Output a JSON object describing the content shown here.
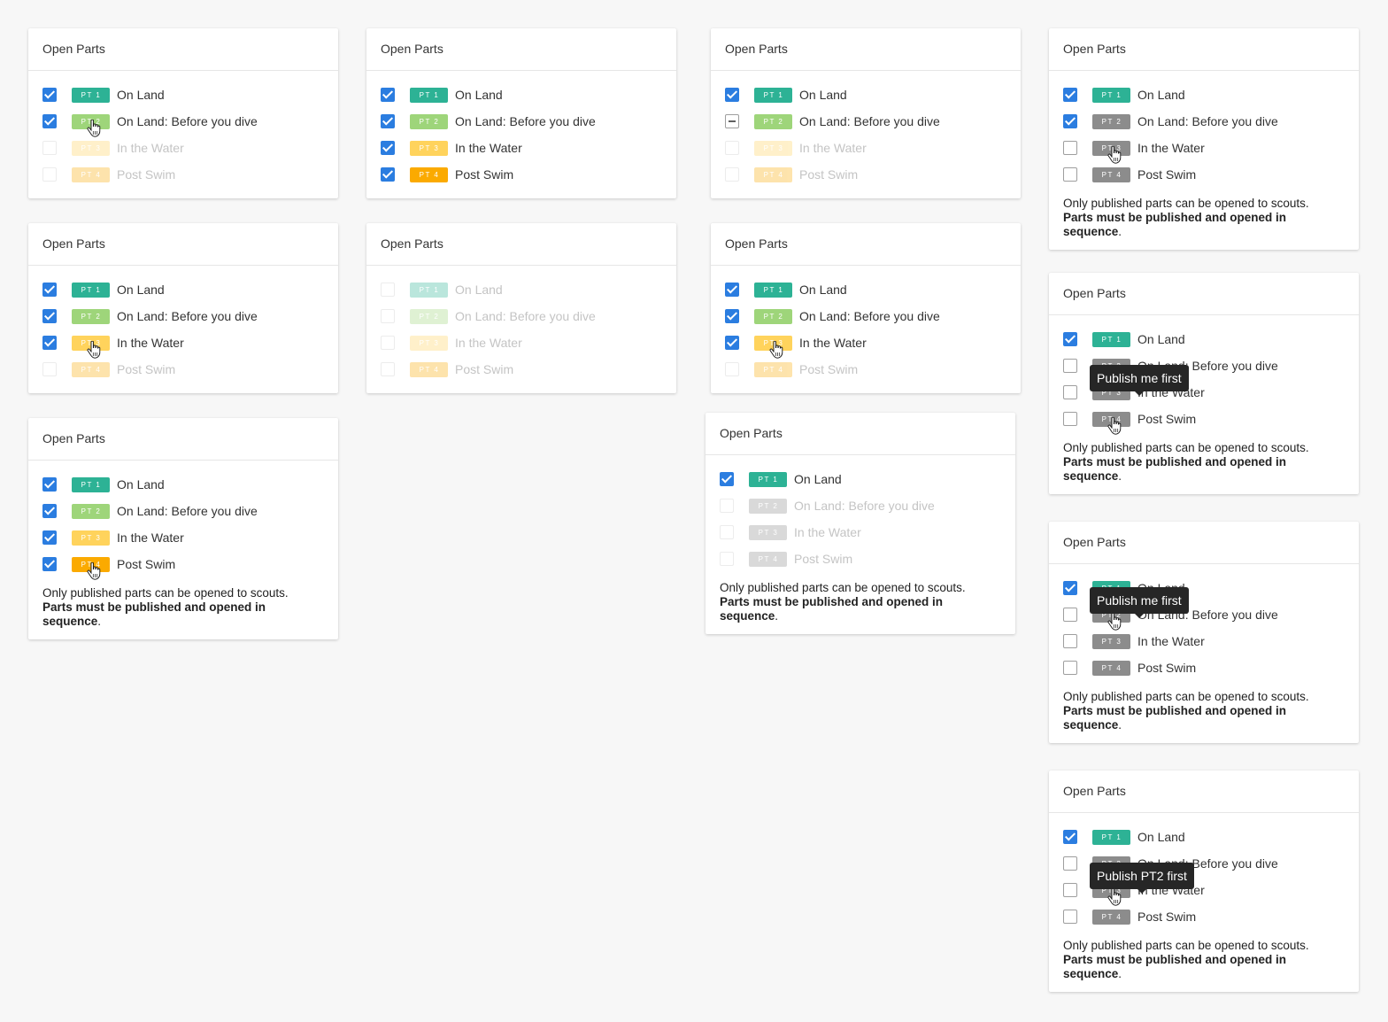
{
  "header_title": "Open Parts",
  "note_plain": "Only published parts can be opened to scouts.",
  "note_bold": "Parts must be published and opened in sequence",
  "note_end": ".",
  "colors": {
    "pt1": "#2db295",
    "pt2": "#9ed57a",
    "pt3": "#ffd35c",
    "pt4": "#fbaa00",
    "unpublished": "#8c8c8c",
    "checkbox": "#2b7de0"
  },
  "cards": [
    {
      "rows": [
        {
          "state": "checked",
          "badge": "PT 1",
          "color": "pt1",
          "label": "On Land"
        },
        {
          "state": "checked",
          "badge": "PT 2",
          "color": "pt2",
          "label": "On Land: Before you dive",
          "cursor": true
        },
        {
          "state": "disabled",
          "badge": "PT 3",
          "color": "pt3",
          "label": "In the Water",
          "faded": true
        },
        {
          "state": "disabled",
          "badge": "PT 4",
          "color": "pt4",
          "label": "Post Swim",
          "faded": true
        }
      ]
    },
    {
      "rows": [
        {
          "state": "checked",
          "badge": "PT 1",
          "color": "pt1",
          "label": "On Land"
        },
        {
          "state": "checked",
          "badge": "PT 2",
          "color": "pt2",
          "label": "On Land: Before you dive"
        },
        {
          "state": "checked",
          "badge": "PT 3",
          "color": "pt3",
          "label": "In the Water"
        },
        {
          "state": "checked",
          "badge": "PT 4",
          "color": "pt4",
          "label": "Post Swim"
        }
      ]
    },
    {
      "rows": [
        {
          "state": "checked",
          "badge": "PT 1",
          "color": "pt1",
          "label": "On Land"
        },
        {
          "state": "indeterminate",
          "badge": "PT 2",
          "color": "pt2",
          "label": "On Land: Before you dive"
        },
        {
          "state": "disabled",
          "badge": "PT 3",
          "color": "pt3",
          "label": "In the Water",
          "faded": true
        },
        {
          "state": "disabled",
          "badge": "PT 4",
          "color": "pt4",
          "label": "Post Swim",
          "faded": true
        }
      ]
    },
    {
      "note": true,
      "rows": [
        {
          "state": "checked",
          "badge": "PT 1",
          "color": "pt1",
          "label": "On Land"
        },
        {
          "state": "checked",
          "badge": "PT 2",
          "color": "unpublished",
          "label": "On Land: Before you dive"
        },
        {
          "state": "unchecked",
          "badge": "PT 3",
          "color": "unpublished",
          "label": "In the Water",
          "cursor": true
        },
        {
          "state": "unchecked",
          "badge": "PT 4",
          "color": "unpublished",
          "label": "Post Swim"
        }
      ]
    },
    {
      "rows": [
        {
          "state": "checked",
          "badge": "PT 1",
          "color": "pt1",
          "label": "On Land"
        },
        {
          "state": "checked",
          "badge": "PT 2",
          "color": "pt2",
          "label": "On Land: Before you dive"
        },
        {
          "state": "checked",
          "badge": "PT 3",
          "color": "pt3",
          "label": "In the Water",
          "cursor": true
        },
        {
          "state": "disabled",
          "badge": "PT 4",
          "color": "pt4",
          "label": "Post Swim",
          "faded": true
        }
      ]
    },
    {
      "rows": [
        {
          "state": "disabled",
          "badge": "PT 1",
          "color": "pt1",
          "label": "On Land",
          "faded": true
        },
        {
          "state": "disabled",
          "badge": "PT 2",
          "color": "pt2",
          "label": "On Land: Before you dive",
          "faded": true
        },
        {
          "state": "disabled",
          "badge": "PT 3",
          "color": "pt3",
          "label": "In the Water",
          "faded": true
        },
        {
          "state": "disabled",
          "badge": "PT 4",
          "color": "pt4",
          "label": "Post Swim",
          "faded": true
        }
      ]
    },
    {
      "rows": [
        {
          "state": "checked",
          "badge": "PT 1",
          "color": "pt1",
          "label": "On Land"
        },
        {
          "state": "checked",
          "badge": "PT 2",
          "color": "pt2",
          "label": "On Land: Before you dive"
        },
        {
          "state": "checked",
          "badge": "PT 3",
          "color": "pt3",
          "label": "In the Water",
          "cursor": true
        },
        {
          "state": "disabled",
          "badge": "PT 4",
          "color": "pt4",
          "label": "Post Swim",
          "faded": true
        }
      ]
    },
    {
      "note": true,
      "rows": [
        {
          "state": "checked",
          "badge": "PT 1",
          "color": "pt1",
          "label": "On Land"
        },
        {
          "state": "checked",
          "badge": "PT 2",
          "color": "pt2",
          "label": "On Land: Before you dive"
        },
        {
          "state": "checked",
          "badge": "PT 3",
          "color": "pt3",
          "label": "In the Water"
        },
        {
          "state": "checked",
          "badge": "PT 4",
          "color": "pt4",
          "label": "Post Swim",
          "cursor": true
        }
      ]
    },
    {
      "note": true,
      "rows": [
        {
          "state": "checked",
          "badge": "PT 1",
          "color": "pt1",
          "label": "On Land"
        },
        {
          "state": "unchecked",
          "badge": "PT 2",
          "color": "unpublished",
          "label": "On Land: Before you dive"
        },
        {
          "state": "unchecked",
          "badge": "PT 3",
          "color": "unpublished",
          "label": "In the Water"
        },
        {
          "state": "unchecked",
          "badge": "PT 4",
          "color": "unpublished",
          "label": "Post Swim",
          "cursor": true
        }
      ],
      "tooltip": {
        "text": "Publish me first",
        "row": 1
      }
    },
    {
      "note": true,
      "rows": [
        {
          "state": "checked",
          "badge": "PT 1",
          "color": "pt1",
          "label": "On Land"
        },
        {
          "state": "unchecked",
          "badge": "PT 2",
          "color": "unpublished",
          "label": "On Land: Before you dive",
          "cursor": true
        },
        {
          "state": "unchecked",
          "badge": "PT 3",
          "color": "unpublished",
          "label": "In the Water"
        },
        {
          "state": "unchecked",
          "badge": "PT 4",
          "color": "unpublished",
          "label": "Post Swim"
        }
      ],
      "tooltip": {
        "text": "Publish me first",
        "row": 0
      }
    },
    {
      "note": true,
      "rows": [
        {
          "state": "checked",
          "badge": "PT 1",
          "color": "pt1",
          "label": "On Land"
        },
        {
          "state": "unchecked",
          "badge": "PT 2",
          "color": "unpublished",
          "label": "On Land: Before you dive"
        },
        {
          "state": "unchecked",
          "badge": "PT 3",
          "color": "unpublished",
          "label": "In the Water",
          "cursor": true
        },
        {
          "state": "unchecked",
          "badge": "PT 4",
          "color": "unpublished",
          "label": "Post Swim"
        }
      ],
      "tooltip": {
        "text": "Publish PT2 first",
        "row": 1
      }
    }
  ]
}
